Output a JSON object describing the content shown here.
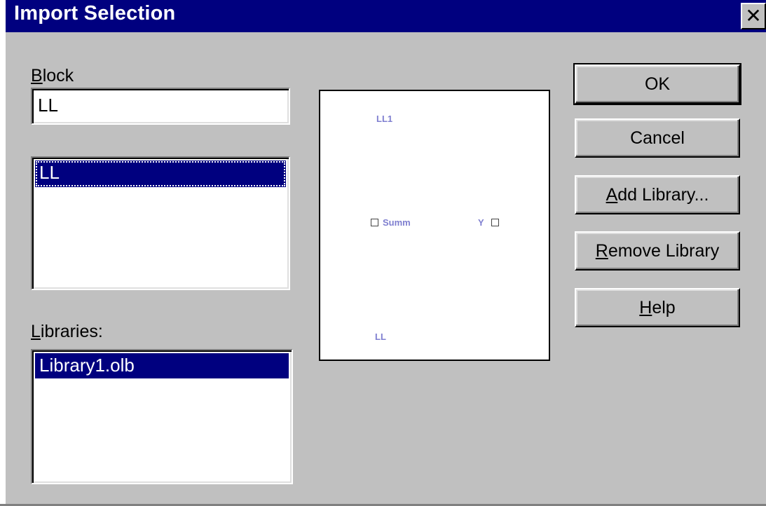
{
  "window": {
    "title": "Import Selection",
    "close_glyph": "✕"
  },
  "block": {
    "label_mnemonic": "B",
    "label_rest": "lock",
    "value": "LL",
    "list": [
      "LL"
    ],
    "selected": "LL"
  },
  "libraries": {
    "label_mnemonic": "L",
    "label_rest": "ibraries:",
    "items": [
      "Library1.olb"
    ],
    "selected": "Library1.olb"
  },
  "preview": {
    "ref_label": "LL1",
    "pin_left_name": "Summ",
    "pin_right_name": "Y",
    "value_label": "LL",
    "text_color": "#7f7fd0"
  },
  "buttons": {
    "ok": "OK",
    "cancel": "Cancel",
    "add_library_mnemonic": "A",
    "add_library_rest": "dd Library...",
    "remove_library_mnemonic": "R",
    "remove_library_rest": "emove Library",
    "help_mnemonic": "H",
    "help_rest": "elp"
  },
  "colors": {
    "titlebar": "#00007f",
    "face": "#c0c0c0",
    "selection": "#00007f"
  }
}
